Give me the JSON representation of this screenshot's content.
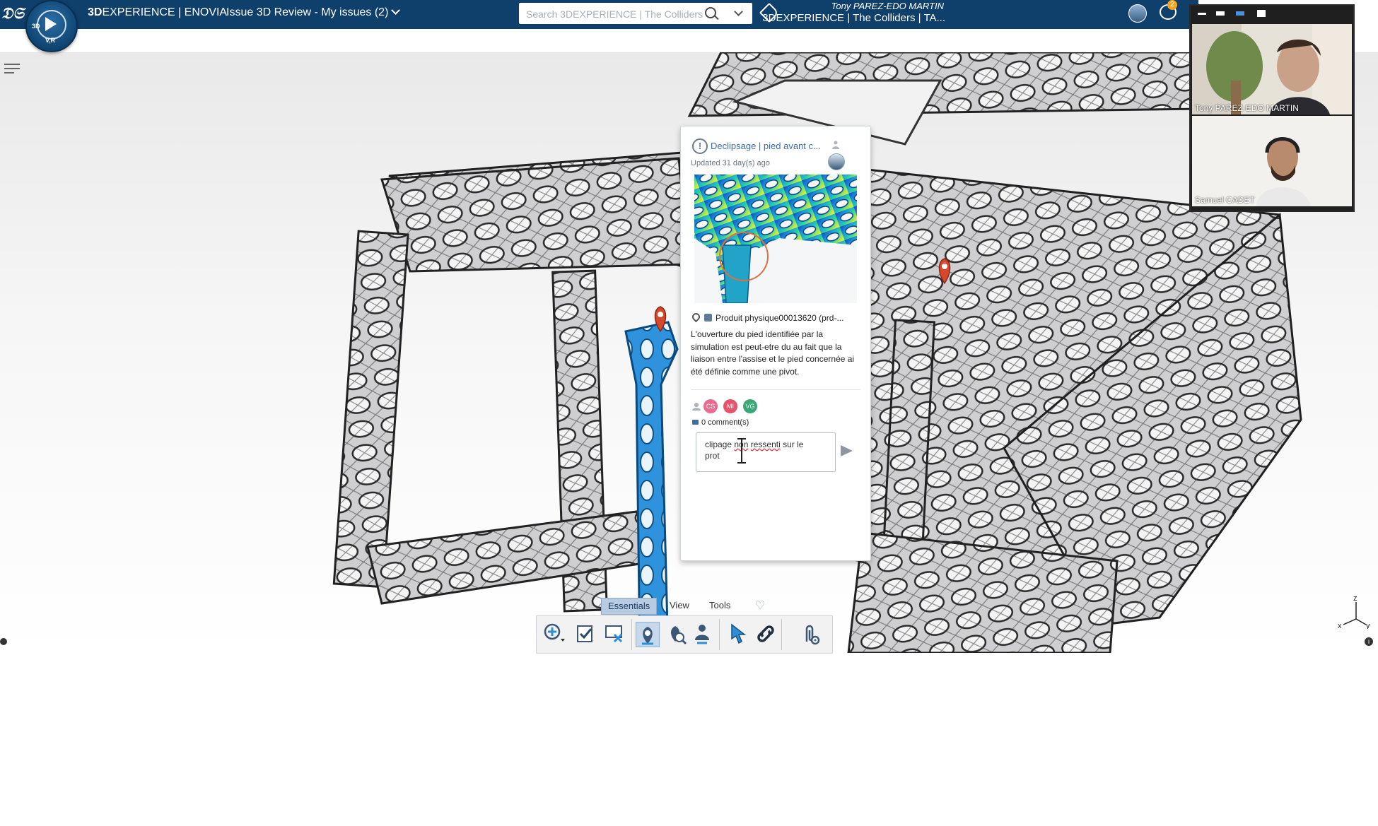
{
  "header": {
    "app_name_bold": "3D",
    "app_name_rest": "EXPERIENCE | ENOVIA",
    "issue_view_title": "Issue 3D Review - My issues (2)",
    "search_placeholder": "Search 3DEXPERIENCE | The Colliders",
    "user_name": "Tony PAREZ-EDO MARTIN",
    "platform": "3DEXPERIENCE | The Colliders | TA...",
    "notification_count": "2",
    "compass_version": "V,R",
    "compass_label": "3D"
  },
  "issue_card": {
    "title": "Declipsage | pied avant c...",
    "updated": "Updated 31 day(s) ago",
    "location": "Produit physique00013620 (prd-...",
    "description": "L'ouverture du pied identifiée par la simulation est peut-etre du au fait que la liaison entre l'assise et le pied concernée ai été définie comme une pivot.",
    "assignees": [
      "CS",
      "MI",
      "VG"
    ],
    "assignee_colors": [
      "#e96b8e",
      "#e9506a",
      "#3aa774"
    ],
    "comments_count": "0 comment(s)",
    "comment_draft_line1": "clipage ",
    "comment_draft_word1": "non",
    "comment_draft_word2": "ressenti",
    "comment_draft_line1_end": " sur le",
    "comment_draft_line2": "prot"
  },
  "video_call": {
    "participants": [
      "Tony PAREZ-EDO MARTIN",
      "Samuel CADET"
    ]
  },
  "action_bar": {
    "tabs": [
      "Essentials",
      "View",
      "Tools"
    ],
    "active_tab": "Essentials"
  },
  "axis_labels": {
    "x": "x",
    "y": "y",
    "z": "z"
  },
  "colors": {
    "topbar": "#0f3f6b",
    "link": "#3d6ea0",
    "pin": "#d9472b",
    "selection": "#2e8fd8"
  }
}
